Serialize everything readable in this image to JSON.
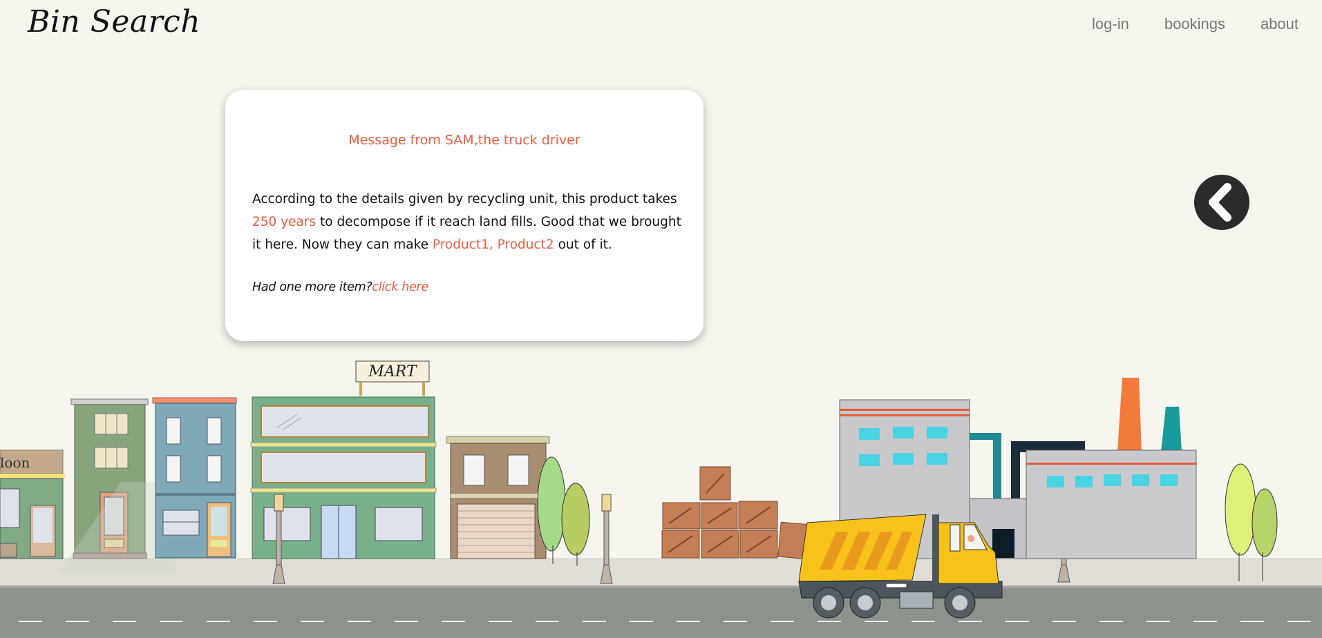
{
  "header": {
    "logo": "Bin Search",
    "nav": [
      {
        "label": "log-in"
      },
      {
        "label": "bookings"
      },
      {
        "label": "about"
      }
    ]
  },
  "message": {
    "title": "Message from SAM,the truck driver",
    "line1": "According to the details given by recycling unit, this product takes",
    "years": "250 years",
    "line2": " to decompose if it reach land fills. Good that we brought it",
    "line3": "here. Now they can make ",
    "products": "Product1, Product2",
    "line4": " out of it.",
    "more_prompt": "Had one more item?",
    "more_link": "click here"
  },
  "back_button": {
    "icon": "chevron-left-icon"
  },
  "scene": {
    "mart_sign": "MART",
    "saloon_sign": "loon"
  },
  "colors": {
    "background": "#f6f5ee",
    "accent": "#f05a3c",
    "road": "#8c938c",
    "sidewalk": "#e0ddd6",
    "truck_yellow": "#f7c21a"
  }
}
